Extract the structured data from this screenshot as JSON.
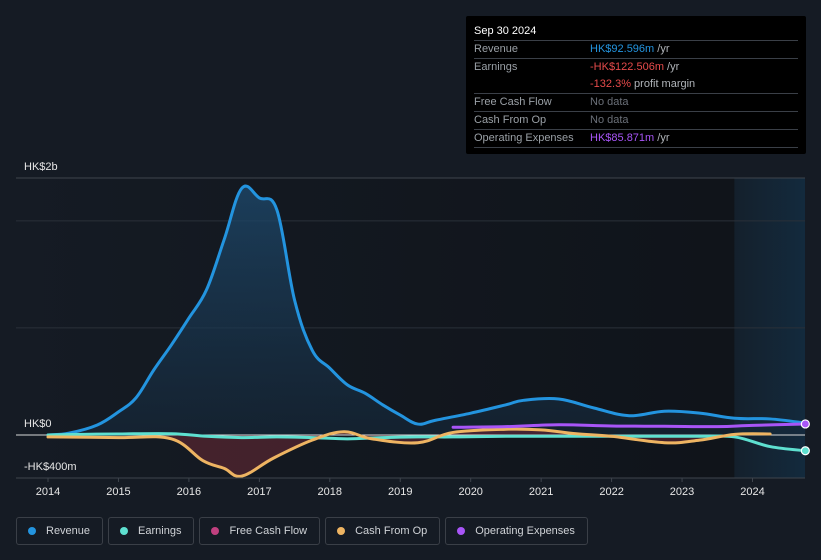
{
  "tooltip": {
    "date": "Sep 30 2024",
    "rows": [
      {
        "label": "Revenue",
        "value": "HK$92.596m",
        "unit": " /yr",
        "color": "#2394df"
      },
      {
        "label": "Earnings",
        "value": "-HK$122.506m",
        "unit": " /yr",
        "color": "#e64b4b"
      },
      {
        "label": "",
        "value": "-132.3%",
        "unit": " profit margin",
        "color": "#e64b4b"
      },
      {
        "label": "Free Cash Flow",
        "value": "No data",
        "unit": "",
        "color": "#6b7079"
      },
      {
        "label": "Cash From Op",
        "value": "No data",
        "unit": "",
        "color": "#6b7079"
      },
      {
        "label": "Operating Expenses",
        "value": "HK$85.871m",
        "unit": " /yr",
        "color": "#a855f7"
      }
    ]
  },
  "legend": [
    {
      "label": "Revenue",
      "color": "#2394df"
    },
    {
      "label": "Earnings",
      "color": "#5ee0d0"
    },
    {
      "label": "Free Cash Flow",
      "color": "#c0407f"
    },
    {
      "label": "Cash From Op",
      "color": "#eeb462"
    },
    {
      "label": "Operating Expenses",
      "color": "#a855f7"
    }
  ],
  "chart_data": {
    "type": "area",
    "title": "",
    "xlabel": "",
    "ylabel": "",
    "y_unit": "HK$m",
    "ylim": [
      -330,
      2000
    ],
    "y_tick_labels": [
      {
        "value": 2000,
        "label": "HK$2b"
      },
      {
        "value": 0,
        "label": "HK$0"
      },
      {
        "value": -400,
        "label": "-HK$400m"
      }
    ],
    "x_tick_labels": [
      "2014",
      "2015",
      "2016",
      "2017",
      "2018",
      "2019",
      "2020",
      "2021",
      "2022",
      "2023",
      "2024"
    ],
    "xlim": [
      2014,
      2024.75
    ],
    "highlight_range": [
      2023.75,
      2024.75
    ],
    "grid": true,
    "series": [
      {
        "name": "Revenue",
        "color": "#2394df",
        "fill": true,
        "x": [
          2014.0,
          2014.3,
          2014.7,
          2015.0,
          2015.25,
          2015.5,
          2015.75,
          2016.0,
          2016.25,
          2016.5,
          2016.75,
          2017.0,
          2017.25,
          2017.5,
          2017.75,
          2018.0,
          2018.25,
          2018.5,
          2018.75,
          2019.0,
          2019.25,
          2019.5,
          2020.0,
          2020.5,
          2020.75,
          2021.25,
          2021.75,
          2022.25,
          2022.75,
          2023.25,
          2023.75,
          2024.25,
          2024.75
        ],
        "values": [
          0,
          15,
          78,
          180,
          290,
          505,
          700,
          910,
          1130,
          1520,
          1920,
          1845,
          1750,
          1050,
          660,
          520,
          390,
          325,
          235,
          155,
          85,
          115,
          170,
          235,
          270,
          280,
          210,
          150,
          185,
          170,
          130,
          125,
          93
        ]
      },
      {
        "name": "Earnings",
        "color": "#5ee0d0",
        "fill": false,
        "x": [
          2014.0,
          2014.5,
          2015.0,
          2015.75,
          2016.25,
          2016.75,
          2017.25,
          2017.75,
          2018.25,
          2018.75,
          2019.25,
          2019.75,
          2020.5,
          2021.5,
          2022.5,
          2023.25,
          2023.75,
          2024.25,
          2024.75
        ],
        "values": [
          0,
          5,
          8,
          10,
          -10,
          -20,
          -15,
          -20,
          -30,
          -20,
          -15,
          -15,
          -10,
          -10,
          -10,
          -10,
          -15,
          -90,
          -122.5
        ]
      },
      {
        "name": "Free Cash Flow",
        "color": "#c0407f",
        "fill": true,
        "fill_only": true,
        "x": [
          2014.0,
          2015.0,
          2015.75,
          2016.2,
          2016.5,
          2016.75,
          2017.2,
          2017.75,
          2018.2,
          2018.6,
          2019.25,
          2019.75,
          2020.5,
          2021.0,
          2021.5,
          2022.0,
          2022.75,
          2023.25,
          2023.75,
          2024.25
        ],
        "values": [
          -15,
          -20,
          -30,
          -200,
          -260,
          -320,
          -180,
          -40,
          20,
          -30,
          -60,
          15,
          40,
          35,
          10,
          -10,
          -60,
          -40,
          0,
          5
        ]
      },
      {
        "name": "Cash From Op",
        "color": "#eeb462",
        "fill": false,
        "x": [
          2014.0,
          2015.0,
          2015.75,
          2016.2,
          2016.5,
          2016.75,
          2017.2,
          2017.75,
          2018.2,
          2018.6,
          2019.25,
          2019.75,
          2020.5,
          2021.0,
          2021.5,
          2022.0,
          2022.75,
          2023.25,
          2023.75,
          2024.25
        ],
        "values": [
          -15,
          -20,
          -30,
          -200,
          -260,
          -320,
          -180,
          -40,
          25,
          -30,
          -60,
          20,
          45,
          40,
          10,
          -10,
          -60,
          -40,
          5,
          8
        ]
      },
      {
        "name": "Operating Expenses",
        "color": "#a855f7",
        "fill": false,
        "x": [
          2019.75,
          2020.5,
          2021.25,
          2022.0,
          2022.75,
          2023.5,
          2024.0,
          2024.75
        ],
        "values": [
          60,
          65,
          80,
          70,
          68,
          65,
          75,
          86
        ]
      }
    ]
  }
}
